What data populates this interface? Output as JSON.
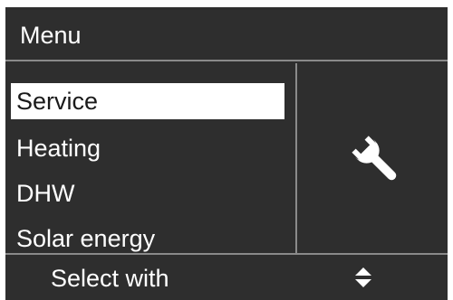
{
  "header": {
    "title": "Menu"
  },
  "menu": {
    "items": [
      {
        "label": "Service",
        "selected": true
      },
      {
        "label": "Heating",
        "selected": false
      },
      {
        "label": "DHW",
        "selected": false
      },
      {
        "label": "Solar energy",
        "selected": false
      }
    ]
  },
  "panel": {
    "icon": "wrench-icon"
  },
  "footer": {
    "hint": "Select with",
    "icon": "up-down-arrows-icon"
  },
  "colors": {
    "background": "#2e2e2e",
    "divider": "#8a8a8a",
    "text": "#ffffff",
    "highlight": "#ffffff"
  }
}
